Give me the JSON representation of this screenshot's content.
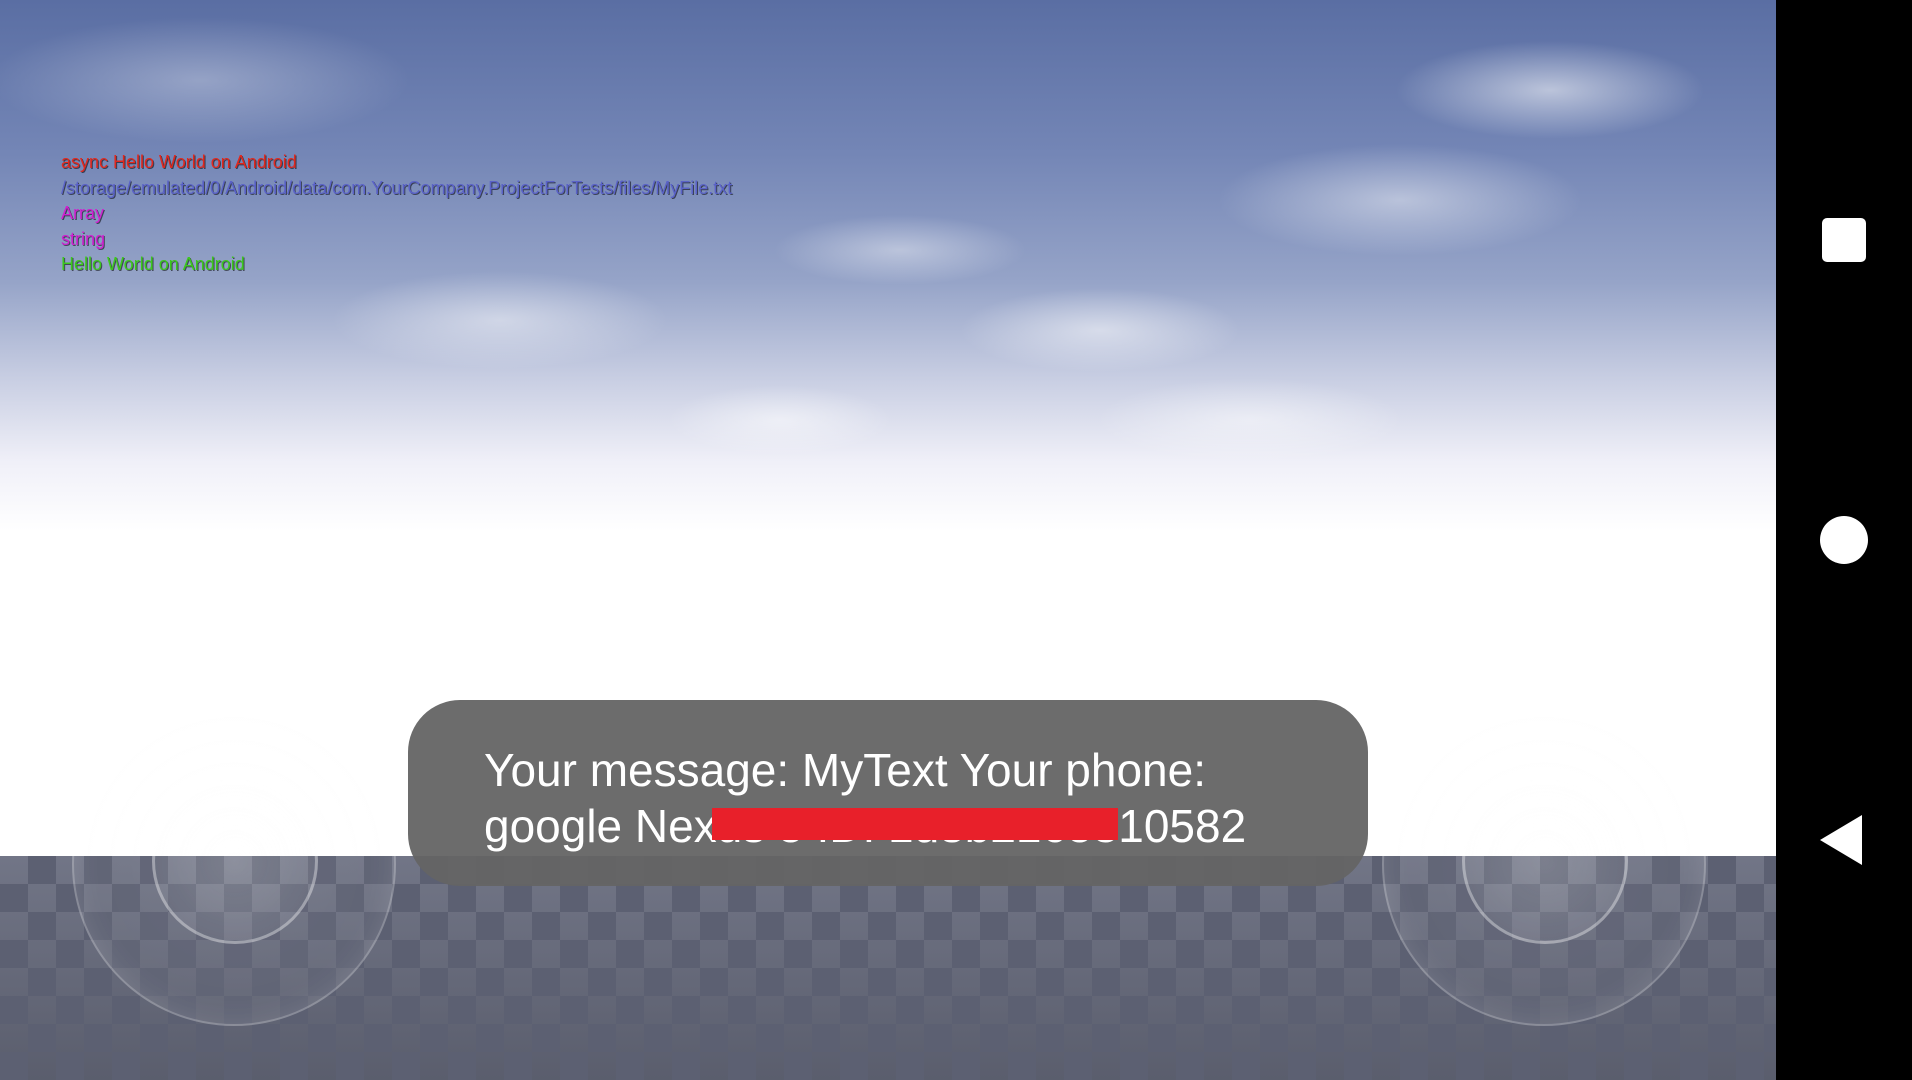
{
  "log": {
    "lines": [
      {
        "text": "async Hello World on Android",
        "color": "#e0281e"
      },
      {
        "text": "/storage/emulated/0/Android/data/com.YourCompany.ProjectForTests/files/MyFile.txt",
        "color": "#5a62c8"
      },
      {
        "text": "Array",
        "color": "#d020d0"
      },
      {
        "text": "string",
        "color": "#d020d0"
      },
      {
        "text": "Hello World on Android",
        "color": "#3cc81e"
      }
    ]
  },
  "toast": {
    "text": "Your message: MyText Your phone: google Nexus 5 ID: 1d3b2165810582"
  },
  "navbar": {
    "recents_icon": "square-icon",
    "home_icon": "circle-icon",
    "back_icon": "triangle-back-icon"
  },
  "colors": {
    "redaction": "#e8202a",
    "toast_bg": "#646464",
    "navbar_bg": "#000000"
  }
}
